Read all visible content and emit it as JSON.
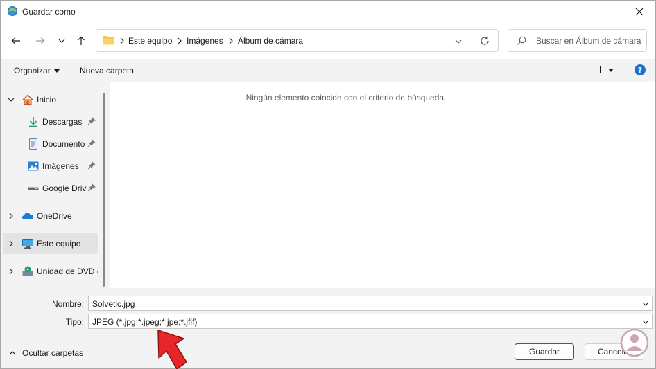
{
  "window": {
    "title": "Guardar como"
  },
  "nav": {
    "breadcrumb": [
      "Este equipo",
      "Imágenes",
      "Álbum de cámara"
    ],
    "search_placeholder": "Buscar en Álbum de cámara"
  },
  "toolbar": {
    "organize_label": "Organizar",
    "new_folder_label": "Nueva carpeta",
    "help_glyph": "?"
  },
  "sidebar": {
    "items": [
      {
        "label": "Inicio",
        "icon": "home-icon"
      },
      {
        "label": "Descargas",
        "icon": "download-icon",
        "pinned": true
      },
      {
        "label": "Documentos",
        "icon": "document-icon",
        "pinned": true
      },
      {
        "label": "Imágenes",
        "icon": "pictures-icon",
        "pinned": true
      },
      {
        "label": "Google Drive",
        "icon": "drive-icon",
        "pinned": true
      },
      {
        "label": "OneDrive",
        "icon": "cloud-icon"
      },
      {
        "label": "Este equipo",
        "icon": "computer-icon",
        "selected": true
      },
      {
        "label": "Unidad de DVD (",
        "icon": "dvd-icon"
      }
    ]
  },
  "content": {
    "empty_message": "Ningún elemento coincide con el criterio de búsqueda."
  },
  "form": {
    "name_label": "Nombre:",
    "name_value": "Solvetic.jpg",
    "type_label": "Tipo:",
    "type_value": "JPEG (*.jpg;*.jpeg;*.jpe;*.jfif)"
  },
  "footer": {
    "hide_folders_label": "Ocultar carpetas",
    "save_label": "Guardar",
    "cancel_label": "Cancelar"
  },
  "colors": {
    "accent": "#1a5fb4",
    "annotation_arrow": "#e8262a",
    "selection": "#e3e3e3"
  }
}
